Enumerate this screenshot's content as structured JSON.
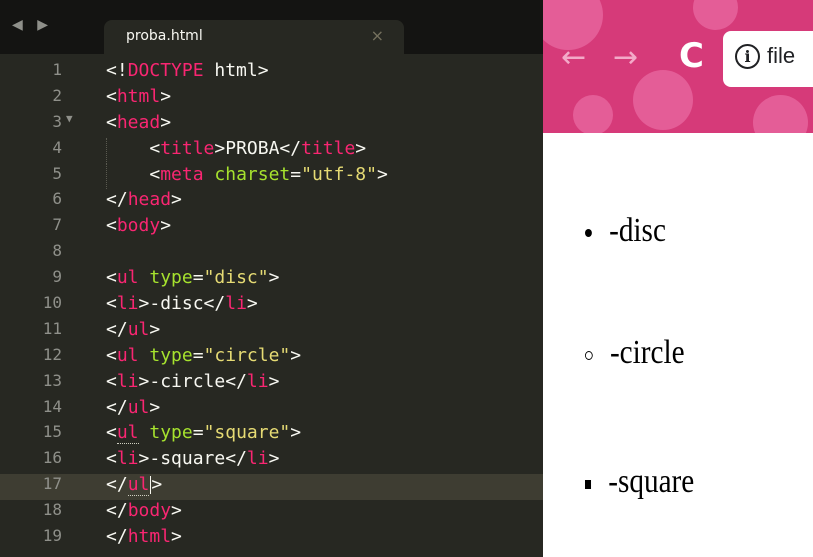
{
  "editor": {
    "tab_title": "proba.html",
    "tab_close": "×",
    "nav_arrows": "◀ ▶",
    "line_numbers": [
      "1",
      "2",
      "3",
      "4",
      "5",
      "6",
      "7",
      "8",
      "9",
      "10",
      "11",
      "12",
      "13",
      "14",
      "15",
      "16",
      "17",
      "18",
      "19"
    ],
    "current_line": 17,
    "fold_marker": "▼",
    "theme": {
      "background": "#272822",
      "tag": "#f92672",
      "attr": "#a6e22e",
      "string": "#e6db74",
      "text": "#f8f8f2"
    }
  },
  "browser": {
    "reload_icon": "reload-icon",
    "back_icon": "arrow-left-icon",
    "forward_icon": "arrow-right-icon",
    "info_glyph": "i",
    "url_text": "file",
    "list_items": [
      "-disc",
      "-circle",
      "-square"
    ],
    "bullet_types": [
      "disc",
      "circle",
      "square"
    ],
    "toolbar_color": "#d63a79"
  }
}
